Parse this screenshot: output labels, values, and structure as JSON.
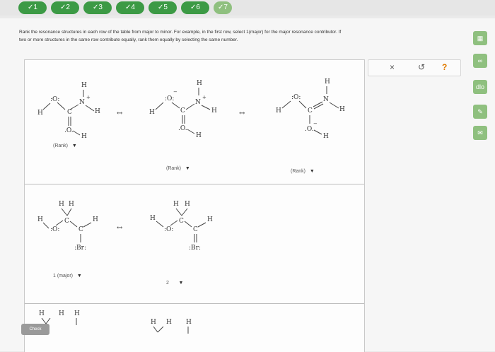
{
  "progress": {
    "steps": [
      {
        "label": "✓1"
      },
      {
        "label": "✓2"
      },
      {
        "label": "✓3"
      },
      {
        "label": "✓4"
      },
      {
        "label": "✓5"
      },
      {
        "label": "✓6"
      },
      {
        "label": "✓7"
      }
    ]
  },
  "instructions": {
    "line1": "Rank the resonance structures in each row of the table from major to minor. For example, in the first row, select 1(major) for the major resonance contributor. If",
    "line2": "two or more structures in the same row contribute equally, rank them equally by selecting the same number."
  },
  "table": {
    "rows": [
      {
        "rank_dropdowns": [
          "(Rank)",
          "(Rank)",
          "(Rank)"
        ],
        "arrow_glyph": "↔"
      },
      {
        "rank_dropdowns": [
          "1 (major)",
          "2"
        ],
        "arrow_glyph": "↔"
      }
    ]
  },
  "molecules": {
    "atom_H": "H",
    "atom_O": "O",
    "atom_C": "C",
    "atom_N": "N",
    "atom_Br": ":Br:",
    "oxy_top": ":O:",
    "oxy_bottom": ".O.",
    "minus": "−",
    "plus": "+"
  },
  "actions": {
    "close_label": "×",
    "undo_label": "↺",
    "help_label": "?"
  },
  "side_tools": {
    "calculator_label": "▦",
    "reference_label": "∞",
    "periodic_label": "dlo",
    "notes_label": "✎",
    "message_label": "✉"
  },
  "check_label": "Check",
  "colors": {
    "completed_step": "#3c9a45",
    "side_button": "#8fc07f"
  }
}
